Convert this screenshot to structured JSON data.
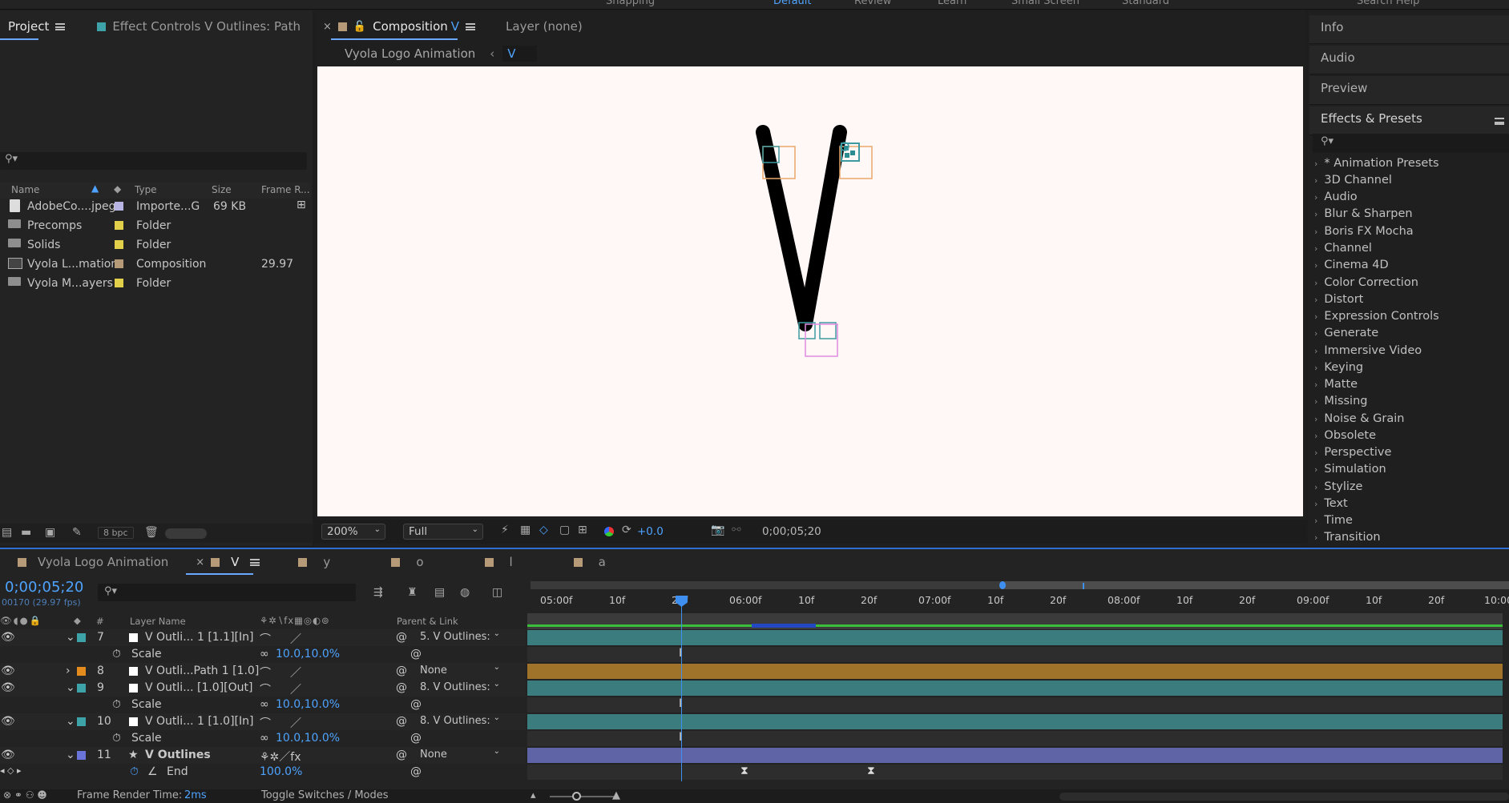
{
  "workspaces": [
    "Snapping",
    "Default",
    "Review",
    "Learn",
    "Small Screen",
    "Standard",
    "Search Help"
  ],
  "project": {
    "tab_label": "Project",
    "effect_controls_tab": "Effect Controls V Outlines: Path",
    "columns": {
      "name": "Name",
      "type": "Type",
      "size": "Size",
      "frame_rate": "Frame R..."
    },
    "items": [
      {
        "name": "AdobeCo....jpeg",
        "type": "Importe...G",
        "size": "69 KB",
        "frame_rate": "",
        "label_color": "#b7b4e3",
        "icon": "image-icon"
      },
      {
        "name": "Precomps",
        "type": "Folder",
        "size": "",
        "frame_rate": "",
        "label_color": "#e2d04a",
        "icon": "folder-icon"
      },
      {
        "name": "Solids",
        "type": "Folder",
        "size": "",
        "frame_rate": "",
        "label_color": "#e2d04a",
        "icon": "folder-icon"
      },
      {
        "name": "Vyola L...mation",
        "type": "Composition",
        "size": "",
        "frame_rate": "29.97",
        "label_color": "#b79a78",
        "icon": "composition-icon"
      },
      {
        "name": "Vyola M...ayers",
        "type": "Folder",
        "size": "",
        "frame_rate": "",
        "label_color": "#e2d04a",
        "icon": "folder-icon"
      }
    ],
    "bpc": "8 bpc"
  },
  "composition": {
    "tab_label": "Composition",
    "tab_comp_name": "V",
    "layer_tab": "Layer  (none)",
    "breadcrumb_parent": "Vyola Logo Animation",
    "breadcrumb_current": "V",
    "zoom": "200%",
    "resolution": "Full",
    "exposure": "+0.0",
    "timecode": "0;00;05;20"
  },
  "right_panel": {
    "sections": [
      "Info",
      "Audio",
      "Preview",
      "Effects & Presets"
    ],
    "presets": [
      "* Animation Presets",
      "3D Channel",
      "Audio",
      "Blur & Sharpen",
      "Boris FX Mocha",
      "Channel",
      "Cinema 4D",
      "Color Correction",
      "Distort",
      "Expression Controls",
      "Generate",
      "Immersive Video",
      "Keying",
      "Matte",
      "Missing",
      "Noise & Grain",
      "Obsolete",
      "Perspective",
      "Simulation",
      "Stylize",
      "Text",
      "Time",
      "Transition"
    ]
  },
  "timeline": {
    "tabs": [
      {
        "label": "Vyola Logo Animation",
        "color": "#b79a78"
      },
      {
        "label": "V",
        "color": "#b79a78"
      },
      {
        "label": "y",
        "color": "#b79a78"
      },
      {
        "label": "o",
        "color": "#b79a78"
      },
      {
        "label": "l",
        "color": "#b79a78"
      },
      {
        "label": "a",
        "color": "#b79a78"
      }
    ],
    "timecode": "0;00;05;20",
    "frame_info": "00170 (29.97 fps)",
    "columns": {
      "num": "#",
      "layer_name": "Layer Name",
      "parent": "Parent & Link"
    },
    "ruler": [
      "05:00f",
      "10f",
      "20f",
      "06:00f",
      "10f",
      "20f",
      "07:00f",
      "10f",
      "20f",
      "08:00f",
      "10f",
      "20f",
      "09:00f",
      "10f",
      "20f",
      "10:00"
    ],
    "rows": [
      {
        "kind": "layer",
        "num": "7",
        "name": "V Outli... 1 [1.1][In]",
        "label_color": "#3ea3a8",
        "parent": "5. V Outlines:",
        "bar_color": "#3b7d7e"
      },
      {
        "kind": "prop",
        "name": "Scale",
        "value": "10.0,10.0%"
      },
      {
        "kind": "layer",
        "num": "8",
        "name": "V Outli...Path 1 [1.0]",
        "label_color": "#e48b1e",
        "parent": "None",
        "bar_color": "#a0732a"
      },
      {
        "kind": "layer",
        "num": "9",
        "name": "V Outli... [1.0][Out]",
        "label_color": "#3ea3a8",
        "parent": "8. V Outlines:",
        "bar_color": "#3b7d7e"
      },
      {
        "kind": "prop",
        "name": "Scale",
        "value": "10.0,10.0%"
      },
      {
        "kind": "layer",
        "num": "10",
        "name": "V Outli... 1 [1.0][In]",
        "label_color": "#3ea3a8",
        "parent": "8. V Outlines:",
        "bar_color": "#3b7d7e"
      },
      {
        "kind": "prop",
        "name": "Scale",
        "value": "10.0,10.0%"
      },
      {
        "kind": "layer",
        "num": "11",
        "name": "V Outlines",
        "label_color": "#6b74d8",
        "parent": "None",
        "bar_color": "#5f64a6"
      },
      {
        "kind": "prop",
        "name": "End",
        "value": "100.0%"
      }
    ],
    "footer": {
      "render_label": "Frame Render Time:",
      "render_value": "2ms",
      "toggle": "Toggle Switches / Modes"
    }
  }
}
